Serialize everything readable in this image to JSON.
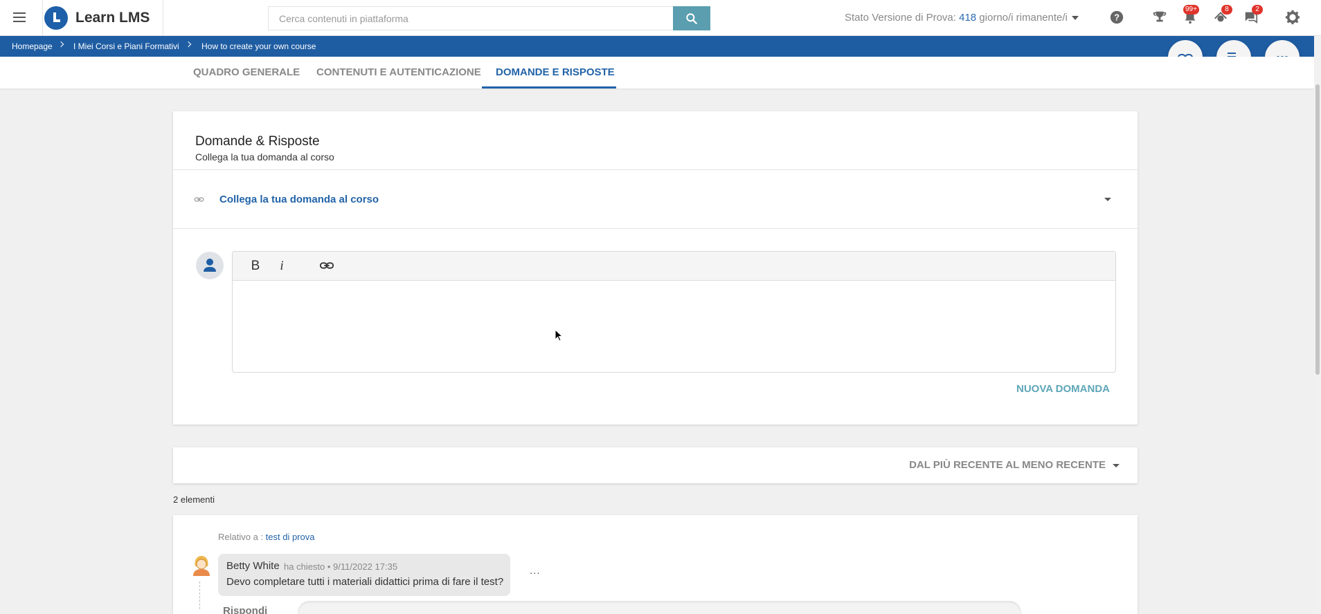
{
  "app": {
    "brand": "Learn LMS"
  },
  "header": {
    "search_placeholder": "Cerca contenuti in piattaforma",
    "trial_prefix": "Stato Versione di Prova: ",
    "trial_days": "418",
    "trial_suffix": " giorno/i rimanente/i",
    "badges": {
      "notifications": "99+",
      "courses": "8",
      "messages": "2"
    }
  },
  "breadcrumb": [
    "Homepage",
    "I Miei Corsi e Piani Formativi",
    "How to create your own course"
  ],
  "tabs": [
    {
      "label": "QUADRO GENERALE",
      "active": false
    },
    {
      "label": "CONTENUTI E AUTENTICAZIONE",
      "active": false
    },
    {
      "label": "DOMANDE E RISPOSTE",
      "active": true
    }
  ],
  "qa_card": {
    "title": "Domande & Risposte",
    "subtitle": "Collega la tua domanda al corso",
    "link_select": "Collega la tua domanda al corso",
    "editor_tools": {
      "bold": "B",
      "italic": "i"
    },
    "submit_label": "NUOVA DOMANDA"
  },
  "sort": {
    "label": "DAL PIÙ RECENTE AL MENO RECENTE"
  },
  "list": {
    "count": "2 elementi",
    "items": [
      {
        "related_prefix": "Relativo a : ",
        "related_link": "test di prova",
        "author": "Betty White",
        "meta": "ha chiesto • 9/11/2022 17:35",
        "text": "Devo completare tutti i materiali didattici prima di fare il test?",
        "more": "...",
        "reply_label": "Rispondi"
      }
    ]
  },
  "colors": {
    "primary": "#1f5da3",
    "accent": "#5ea6b8",
    "badge": "#e0342b"
  }
}
